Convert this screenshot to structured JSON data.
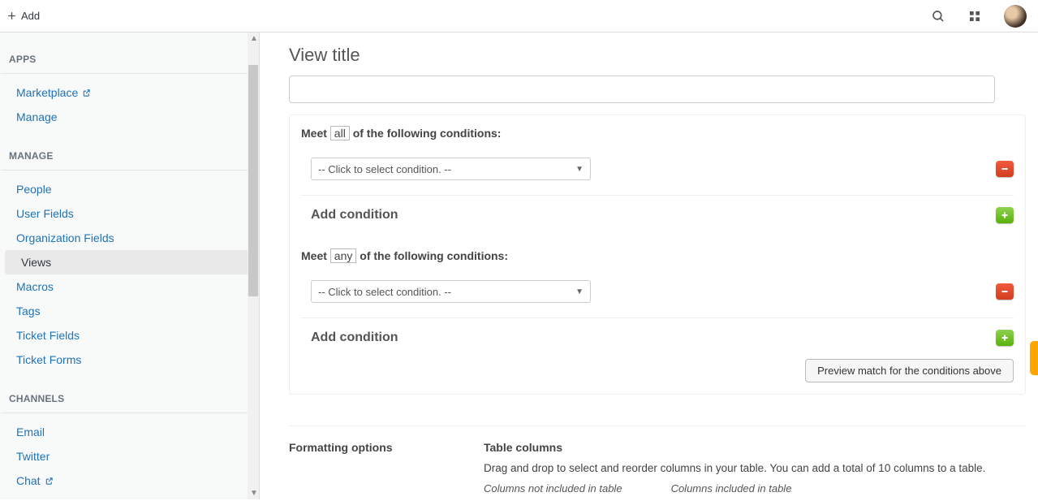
{
  "topbar": {
    "add_label": "Add"
  },
  "sidebar": {
    "groups": [
      {
        "heading": "APPS",
        "items": [
          {
            "label": "Marketplace",
            "external": true
          },
          {
            "label": "Manage"
          }
        ]
      },
      {
        "heading": "MANAGE",
        "items": [
          {
            "label": "People"
          },
          {
            "label": "User Fields"
          },
          {
            "label": "Organization Fields"
          },
          {
            "label": "Views",
            "active": true
          },
          {
            "label": "Macros"
          },
          {
            "label": "Tags"
          },
          {
            "label": "Ticket Fields"
          },
          {
            "label": "Ticket Forms"
          }
        ]
      },
      {
        "heading": "CHANNELS",
        "items": [
          {
            "label": "Email"
          },
          {
            "label": "Twitter"
          },
          {
            "label": "Chat",
            "external": true
          }
        ]
      }
    ]
  },
  "main": {
    "title_heading": "View title",
    "title_value": "",
    "cond_all_pre": "Meet ",
    "cond_all_quant": "all",
    "cond_all_post": " of the following conditions:",
    "cond_any_pre": "Meet ",
    "cond_any_quant": "any",
    "cond_any_post": " of the following conditions:",
    "select_placeholder": "-- Click to select condition. --",
    "add_condition_label": "Add condition",
    "preview_label": "Preview match for the conditions above",
    "formatting": {
      "heading": "Formatting options",
      "table_heading": "Table columns",
      "table_help": "Drag and drop to select and reorder columns in your table. You can add a total of 10 columns to a table.",
      "col_not_included": "Columns not included in table",
      "col_included": "Columns included in table"
    }
  }
}
